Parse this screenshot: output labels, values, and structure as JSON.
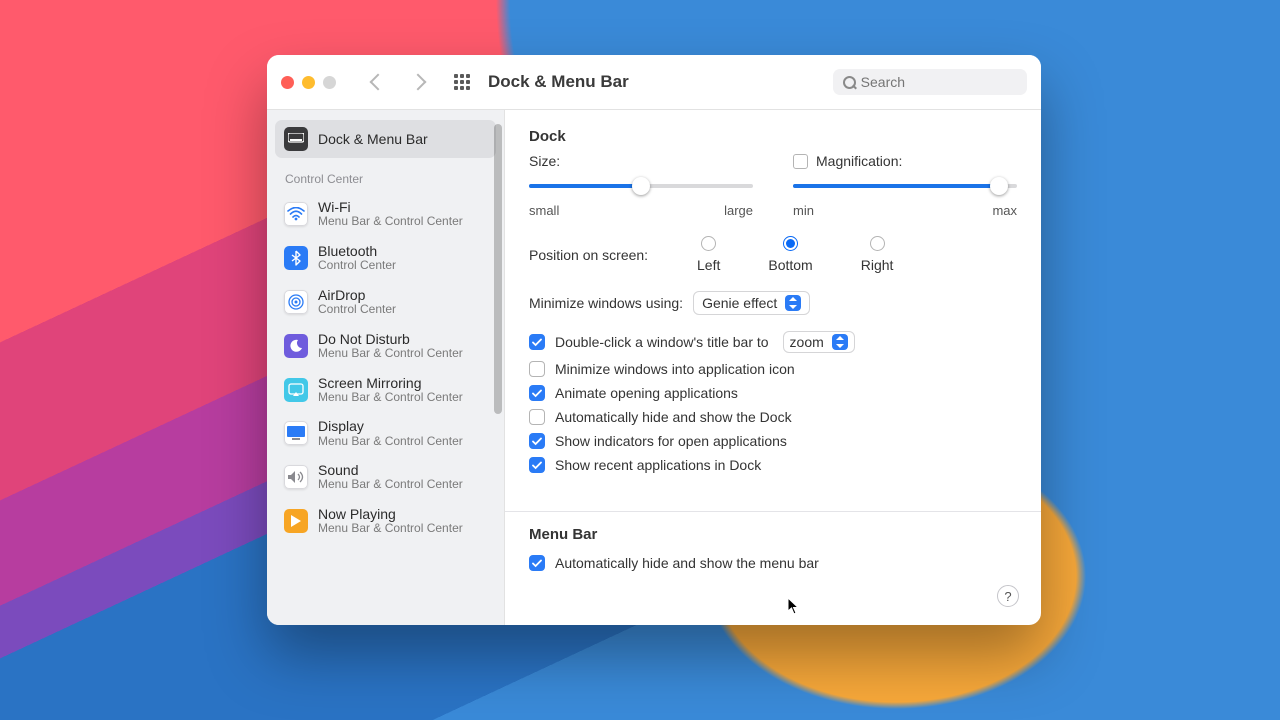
{
  "window": {
    "title": "Dock & Menu Bar",
    "search_placeholder": "Search",
    "traffic": {
      "close": "#ff5f57",
      "min": "#febc2e",
      "max": "#d6d6d6"
    }
  },
  "sidebar": {
    "active": {
      "label": "Dock & Menu Bar",
      "icon": "dock-icon",
      "bg": "#3a3a3c"
    },
    "section_header": "Control Center",
    "items": [
      {
        "label": "Wi-Fi",
        "sub": "Menu Bar & Control Center",
        "icon": "wifi-icon",
        "bg": "#ffffff",
        "fg": "#2a7bf6"
      },
      {
        "label": "Bluetooth",
        "sub": "Control Center",
        "icon": "bluetooth-icon",
        "bg": "#2a7bf6",
        "fg": "#ffffff"
      },
      {
        "label": "AirDrop",
        "sub": "Control Center",
        "icon": "airdrop-icon",
        "bg": "#ffffff",
        "fg": "#2a7bf6"
      },
      {
        "label": "Do Not Disturb",
        "sub": "Menu Bar & Control Center",
        "icon": "moon-icon",
        "bg": "#6f5cdd",
        "fg": "#ffffff"
      },
      {
        "label": "Screen Mirroring",
        "sub": "Menu Bar & Control Center",
        "icon": "mirroring-icon",
        "bg": "#42c8e8",
        "fg": "#ffffff"
      },
      {
        "label": "Display",
        "sub": "Menu Bar & Control Center",
        "icon": "display-icon",
        "bg": "#ffffff",
        "fg": "#2a7bf6"
      },
      {
        "label": "Sound",
        "sub": "Menu Bar & Control Center",
        "icon": "sound-icon",
        "bg": "#ffffff",
        "fg": "#8a8a8f"
      },
      {
        "label": "Now Playing",
        "sub": "Menu Bar & Control Center",
        "icon": "play-icon",
        "bg": "#f7a524",
        "fg": "#ffffff"
      }
    ]
  },
  "dock": {
    "heading": "Dock",
    "size_label": "Size:",
    "size_min": "small",
    "size_max": "large",
    "size_value": 0.5,
    "mag_label": "Magnification:",
    "mag_checked": false,
    "mag_min": "min",
    "mag_max": "max",
    "mag_value": 0.92,
    "position_label": "Position on screen:",
    "positions": {
      "left": "Left",
      "bottom": "Bottom",
      "right": "Right"
    },
    "position_selected": "bottom",
    "min_label": "Minimize windows using:",
    "min_value": "Genie effect",
    "dbl_label_pre": "Double-click a window's title bar to",
    "dbl_value": "zoom",
    "checks": [
      {
        "key": "dblclick",
        "checked": true,
        "label": "Double-click a window's title bar to",
        "has_select": true
      },
      {
        "key": "min_into_icon",
        "checked": false,
        "label": "Minimize windows into application icon"
      },
      {
        "key": "animate",
        "checked": true,
        "label": "Animate opening applications"
      },
      {
        "key": "autohide",
        "checked": false,
        "label": "Automatically hide and show the Dock"
      },
      {
        "key": "indicators",
        "checked": true,
        "label": "Show indicators for open applications"
      },
      {
        "key": "recent",
        "checked": true,
        "label": "Show recent applications in Dock"
      }
    ]
  },
  "menubar": {
    "heading": "Menu Bar",
    "check": {
      "checked": true,
      "label": "Automatically hide and show the menu bar"
    }
  },
  "help_label": "?"
}
